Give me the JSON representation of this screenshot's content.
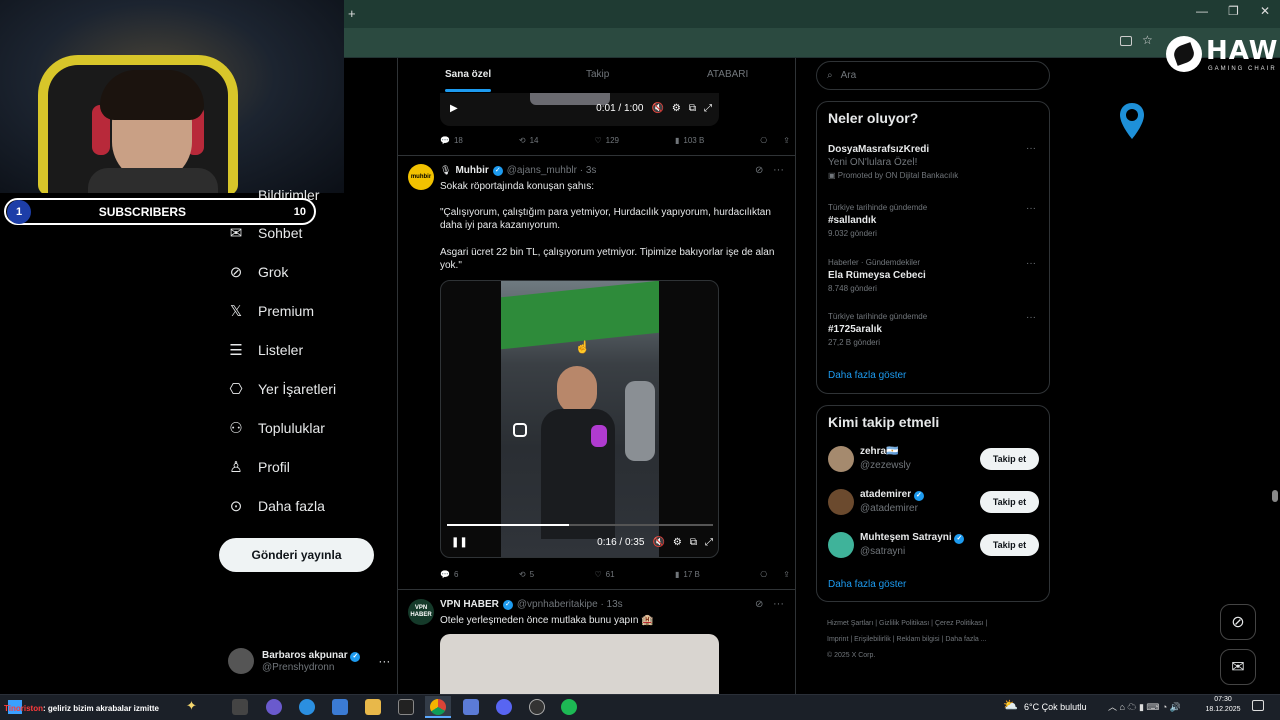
{
  "browser": {
    "new_tab": "+",
    "window_controls": [
      "—",
      "❐",
      "✕"
    ]
  },
  "brand_logo": {
    "title": "HAWK",
    "subtitle": "GAMING CHAIR"
  },
  "stream": {
    "subscribers_label": "SUBSCRIBERS",
    "subscribers_current": "1",
    "subscribers_goal": "10",
    "chat_user": "Tinoriston",
    "chat_message": ": geliriz bizim akrabalar izmitte"
  },
  "sidebar": {
    "partial_item": "Bildirimler",
    "items": [
      {
        "label": "Sohbet",
        "icon": "envelope-icon"
      },
      {
        "label": "Grok",
        "icon": "grok-icon"
      },
      {
        "label": "Premium",
        "icon": "x-logo-icon"
      },
      {
        "label": "Listeler",
        "icon": "list-icon"
      },
      {
        "label": "Yer İşaretleri",
        "icon": "bookmark-icon"
      },
      {
        "label": "Topluluklar",
        "icon": "communities-icon"
      },
      {
        "label": "Profil",
        "icon": "profile-icon"
      },
      {
        "label": "Daha fazla",
        "icon": "more-circle-icon"
      }
    ],
    "post_button": "Gönderi yayınla",
    "account": {
      "name": "Barbaros akpunar",
      "handle": "@Prenshydronn"
    }
  },
  "feed": {
    "tabs": [
      "Sana özel",
      "Takip",
      "ATABARI"
    ],
    "top_video": {
      "time": "0:01 / 1:00"
    },
    "top_metrics": {
      "replies": "18",
      "reposts": "14",
      "likes": "129",
      "views": "103 B"
    },
    "tweet1": {
      "avatar_text": "muhbir",
      "name": "Muhbir",
      "handle": "@ajans_muhblr · 3s",
      "line1": "Sokak röportajında konuşan şahıs:",
      "line2": "\"Çalışıyorum, çalıştığım para yetmiyor, Hurdacılık yapıyorum, hurdacılıktan daha iyi para kazanıyorum.",
      "line3": "Asgari ücret 22 bin TL, çalışıyorum yetmiyor. Tipimize  bakıyorlar işe de alan yok.\"",
      "video_time": "0:16 / 0:35",
      "video_progress": 0.46,
      "metrics": {
        "replies": "6",
        "reposts": "5",
        "likes": "61",
        "views": "17 B"
      }
    },
    "tweet2": {
      "avatar_text": "VPN HABER",
      "name": "VPN HABER",
      "handle": "@vpnhaberitakipe · 13s",
      "text": "Otele yerleşmeden önce mutlaka bunu yapın 🏨"
    }
  },
  "right": {
    "search_placeholder": "Ara",
    "trends_title": "Neler oluyor?",
    "trends": [
      {
        "ctx": "",
        "name": "DosyaMasrafsızKredi",
        "sub": "Yeni ON'lulara Özel!",
        "count": "Promoted by ON Dijital Bankacılık"
      },
      {
        "ctx": "Türkiye tarihinde gündemde",
        "name": "#sallandık",
        "sub": "",
        "count": "9.032 gönderi"
      },
      {
        "ctx": "Haberler · Gündemdekiler",
        "name": "Ela Rümeysa Cebeci",
        "sub": "",
        "count": "8.748 gönderi"
      },
      {
        "ctx": "Türkiye tarihinde gündemde",
        "name": "#1725aralık",
        "sub": "",
        "count": "27,2 B gönderi"
      }
    ],
    "trends_more": "Daha fazla göster",
    "follow_title": "Kimi takip etmeli",
    "follow": [
      {
        "name": "zehra🇦🇷",
        "handle": "@zezewsly",
        "button": "Takip et"
      },
      {
        "name": "atademirer",
        "handle": "@atademirer",
        "button": "Takip et"
      },
      {
        "name": "Muhteşem Satrayni",
        "handle": "@satrayni",
        "button": "Takip et"
      }
    ],
    "follow_more": "Daha fazla göster",
    "footer": [
      "Hizmet Şartları",
      "|",
      "Gizlilik Politikası",
      "|",
      "Çerez Politikası",
      "|",
      "Imprint",
      "|",
      "Erişilebilirlik",
      "|",
      "Reklam bilgisi",
      "|",
      "Daha fazla ...",
      "© 2025 X Corp."
    ]
  },
  "taskbar": {
    "weather": "6°C  Çok bulutlu",
    "time": "07:30",
    "date": "18.12.2025"
  },
  "colors": {
    "accent": "#1d9bf0",
    "chrome": "#1f3b33",
    "background": "#000000"
  }
}
